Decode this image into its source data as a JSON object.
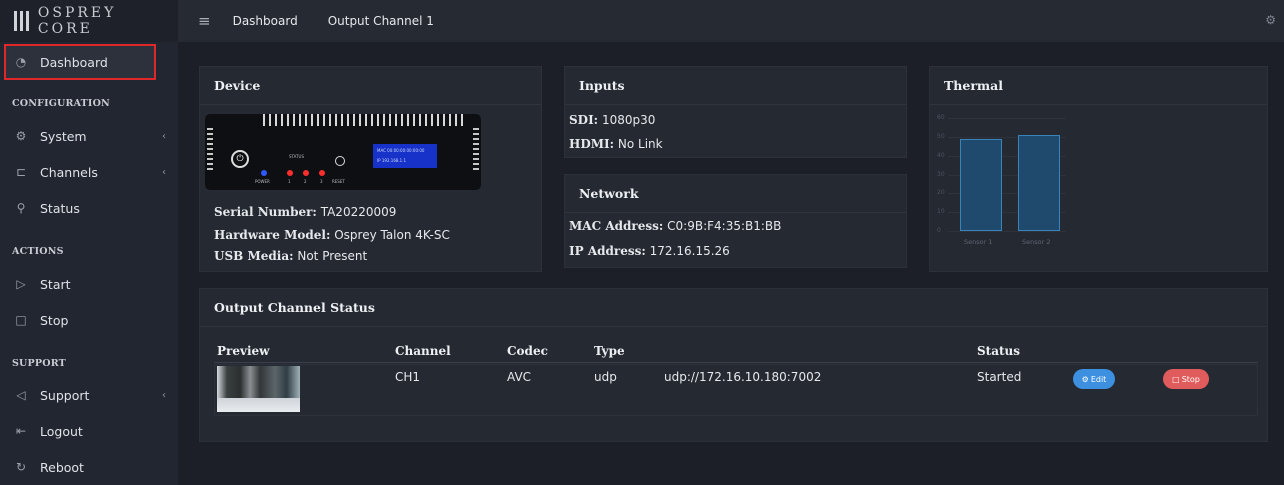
{
  "brand": {
    "name": "OSPREY CORE"
  },
  "topbar": {
    "menu_icon": "menu-icon",
    "crumbs": [
      "Dashboard",
      "Output Channel 1"
    ],
    "settings_icon": "gear-icon"
  },
  "sidebar": {
    "items": [
      {
        "label": "Dashboard",
        "icon": "dashboard-icon",
        "active": true
      },
      {
        "label": "System",
        "icon": "gear-icon",
        "has_submenu": true
      },
      {
        "label": "Channels",
        "icon": "channels-icon",
        "has_submenu": true
      },
      {
        "label": "Status",
        "icon": "search-icon"
      },
      {
        "label": "Start",
        "icon": "play-icon"
      },
      {
        "label": "Stop",
        "icon": "stop-icon"
      },
      {
        "label": "Support",
        "icon": "send-icon",
        "has_submenu": true
      },
      {
        "label": "Logout",
        "icon": "logout-icon"
      },
      {
        "label": "Reboot",
        "icon": "reboot-icon"
      }
    ],
    "sections": [
      "CONFIGURATION",
      "ACTIONS",
      "SUPPORT"
    ],
    "active_outline_color": "#e0282a"
  },
  "device": {
    "title": "Device",
    "image_labels": {
      "status": "STATUS",
      "power": "POWER",
      "led1": "1",
      "led2": "2",
      "led3": "3",
      "reset": "RESET",
      "lcd_mac": "MAC  00:00:00:00:00:00",
      "lcd_ip": "IP    192.168.1.1"
    },
    "serial_label": "Serial Number:",
    "serial_value": "TA20220009",
    "model_label": "Hardware Model:",
    "model_value": "Osprey Talon 4K-SC",
    "usb_label": "USB Media:",
    "usb_value": "Not Present"
  },
  "inputs": {
    "title": "Inputs",
    "sdi_label": "SDI:",
    "sdi_value": "1080p30",
    "hdmi_label": "HDMI:",
    "hdmi_value": "No Link"
  },
  "network": {
    "title": "Network",
    "mac_label": "MAC Address:",
    "mac_value": "C0:9B:F4:35:B1:BB",
    "ip_label": "IP Address:",
    "ip_value": "172.16.15.26"
  },
  "thermal": {
    "title": "Thermal",
    "chart_data": {
      "type": "bar",
      "categories": [
        "Sensor 1",
        "Sensor 2"
      ],
      "values": [
        49,
        51
      ],
      "ylim": [
        0,
        60
      ],
      "yticks": [
        "60",
        "50",
        "40",
        "30",
        "20",
        "10",
        "0"
      ]
    }
  },
  "output_status": {
    "title": "Output Channel Status",
    "columns": [
      "Preview",
      "Channel",
      "Codec",
      "Type",
      "Status"
    ],
    "rows": [
      {
        "channel": "CH1",
        "codec": "AVC",
        "type": "udp",
        "url": "udp://172.16.10.180:7002",
        "status": "Started",
        "edit_label": "Edit",
        "stop_label": "Stop"
      }
    ],
    "edit_color": "#3d8fe0",
    "stop_color": "#e05b5b"
  }
}
